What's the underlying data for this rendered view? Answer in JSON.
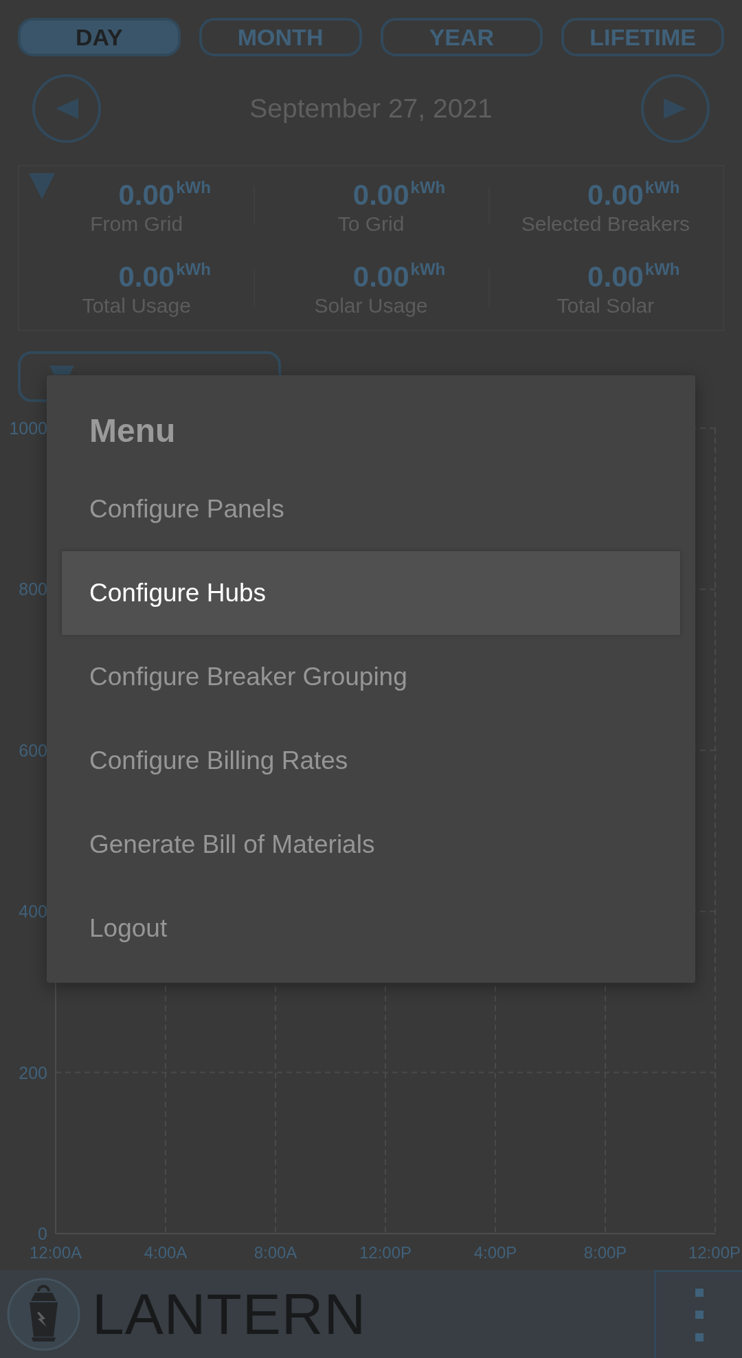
{
  "period_tabs": [
    {
      "label": "DAY",
      "selected": true
    },
    {
      "label": "MONTH",
      "selected": false
    },
    {
      "label": "YEAR",
      "selected": false
    },
    {
      "label": "LIFETIME",
      "selected": false
    }
  ],
  "date_nav": {
    "date": "September 27, 2021"
  },
  "summary": {
    "stats": [
      {
        "value": "0.00",
        "unit": "kWh",
        "label": "From Grid"
      },
      {
        "value": "0.00",
        "unit": "kWh",
        "label": "To Grid"
      },
      {
        "value": "0.00",
        "unit": "kWh",
        "label": "Selected Breakers"
      },
      {
        "value": "0.00",
        "unit": "kWh",
        "label": "Total Usage"
      },
      {
        "value": "0.00",
        "unit": "kWh",
        "label": "Solar Usage"
      },
      {
        "value": "0.00",
        "unit": "kWh",
        "label": "Total Solar"
      }
    ]
  },
  "chart": {
    "chart_data": {
      "type": "line",
      "categories": [
        "12:00A",
        "4:00A",
        "8:00A",
        "12:00P",
        "4:00P",
        "8:00P",
        "12:00P"
      ],
      "ylim": [
        0,
        1000
      ],
      "yticks": [
        0,
        200,
        400,
        600,
        800,
        1000
      ],
      "grid": true
    }
  },
  "footer": {
    "logo_text": "LANTERN"
  },
  "menu": {
    "title": "Menu",
    "items": [
      {
        "label": "Configure Panels",
        "selected": false
      },
      {
        "label": "Configure Hubs",
        "selected": true
      },
      {
        "label": "Configure Breaker Grouping",
        "selected": false
      },
      {
        "label": "Configure Billing Rates",
        "selected": false
      },
      {
        "label": "Generate Bill of Materials",
        "selected": false
      },
      {
        "label": "Logout",
        "selected": false
      }
    ]
  }
}
